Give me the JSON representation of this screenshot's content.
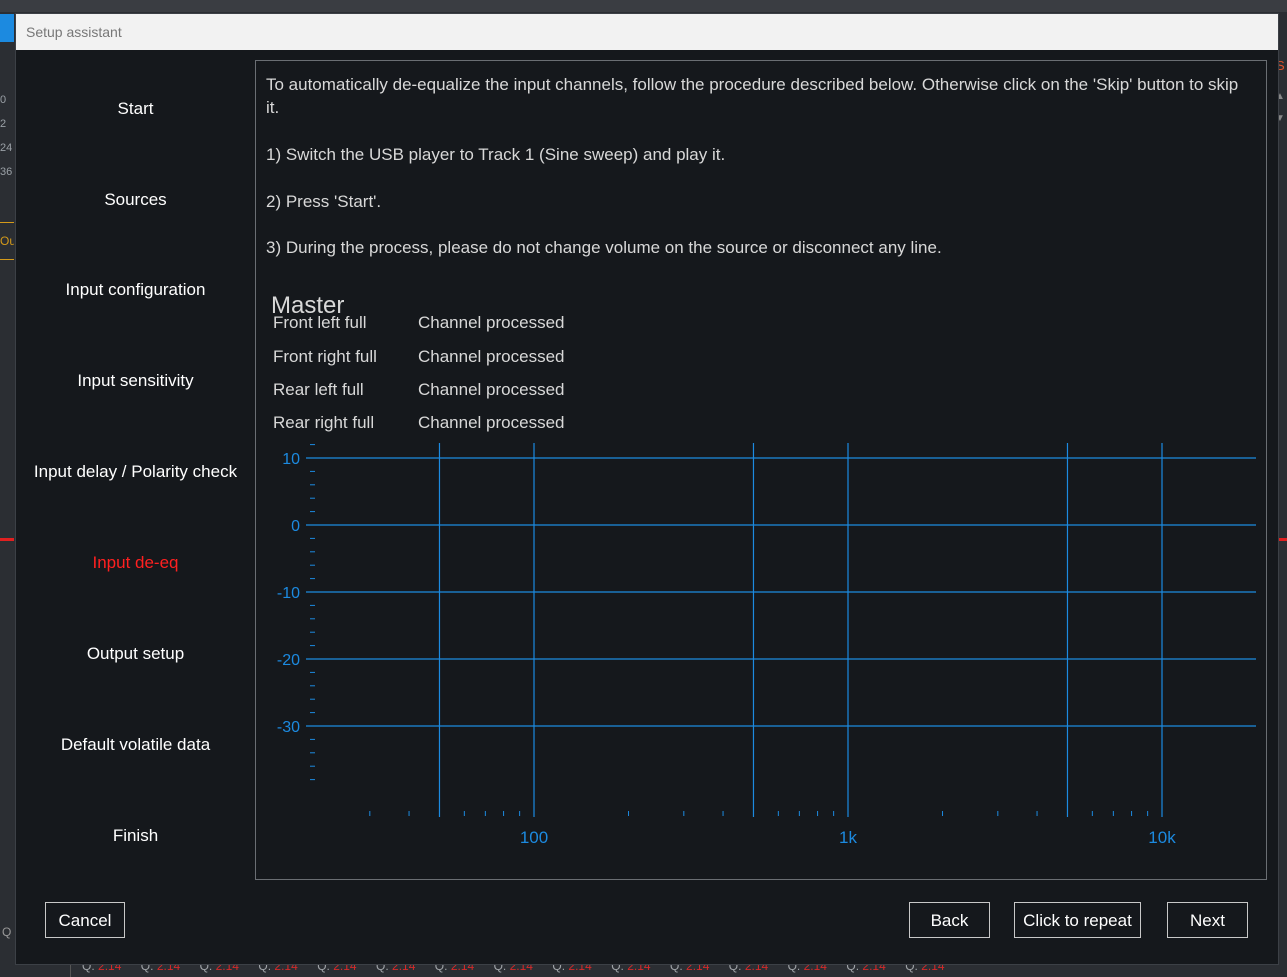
{
  "dialog": {
    "title": "Setup assistant"
  },
  "steps": [
    {
      "label": "Start",
      "active": false
    },
    {
      "label": "Sources",
      "active": false
    },
    {
      "label": "Input configuration",
      "active": false
    },
    {
      "label": "Input sensitivity",
      "active": false
    },
    {
      "label": "Input delay / Polarity check",
      "active": false
    },
    {
      "label": "Input de-eq",
      "active": true
    },
    {
      "label": "Output setup",
      "active": false
    },
    {
      "label": "Default volatile data",
      "active": false
    },
    {
      "label": "Finish",
      "active": false
    }
  ],
  "instructions": {
    "intro": "To automatically de-equalize the input channels, follow the procedure described below. Otherwise click on the 'Skip' button to skip it.",
    "step1": "1) Switch the USB player to Track 1 (Sine sweep) and play it.",
    "step2": "2) Press 'Start'.",
    "step3": "3) During the process, please do not change volume on the source or disconnect any line."
  },
  "group": {
    "title": "Master",
    "channels": [
      {
        "name": "Front left full",
        "status": "Channel processed"
      },
      {
        "name": "Front right full",
        "status": "Channel processed"
      },
      {
        "name": "Rear left full",
        "status": "Channel processed"
      },
      {
        "name": "Rear right full",
        "status": "Channel processed"
      }
    ]
  },
  "chart_data": {
    "type": "line",
    "x_scale": "log",
    "xlim": [
      20,
      20000
    ],
    "ylim": [
      -38,
      14
    ],
    "x_tick_labels": [
      "100",
      "1k",
      "10k"
    ],
    "x_ticks": [
      100,
      1000,
      10000
    ],
    "y_ticks": [
      10,
      0,
      -10,
      -20,
      -30
    ],
    "y_tick_labels": [
      "10",
      "0",
      "-10",
      "-20",
      "-30"
    ],
    "x_gridlines": [
      50,
      100,
      500,
      1000,
      5000,
      10000
    ],
    "y_gridlines": [
      10,
      0,
      -10,
      -20,
      -30
    ],
    "grid": true,
    "series": [],
    "grid_color": "#1c8ae0"
  },
  "buttons": {
    "cancel": "Cancel",
    "back": "Back",
    "repeat": "Click to repeat",
    "next": "Next"
  },
  "background": {
    "left_numbers": [
      "0",
      "2",
      "24",
      "36"
    ],
    "left_label": "Out",
    "right_label": "S",
    "left_q": "Q",
    "q_label": "Q:",
    "q_value": "2.14",
    "q_count": 15
  },
  "colors": {
    "active_step": "#ff2020",
    "accent": "#1c8ae0",
    "q_value": "#d42a2a"
  }
}
